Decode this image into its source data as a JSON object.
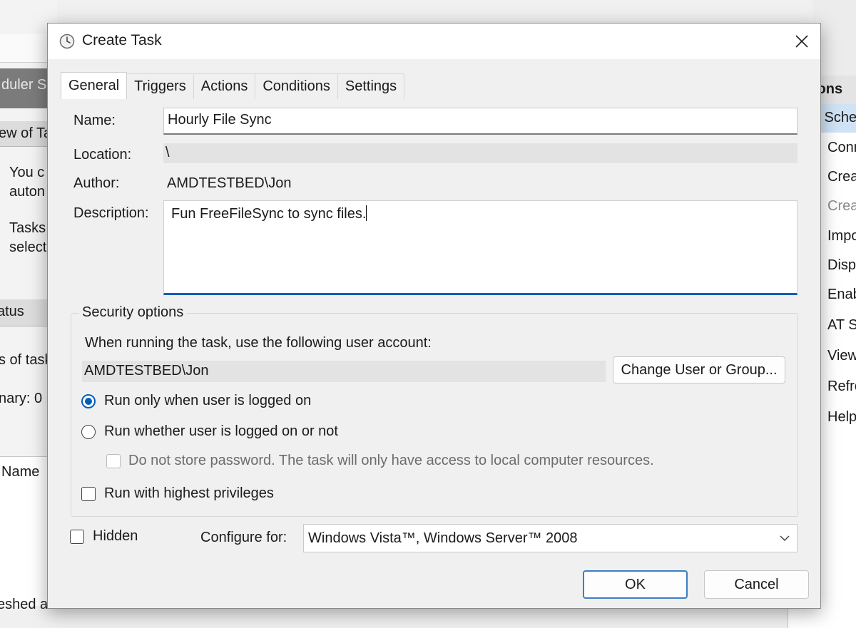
{
  "background": {
    "left_texts": [
      "duler Su",
      "ew of Ta",
      "You c",
      "auton",
      "Tasks",
      "select",
      "atus",
      "s of task",
      "nary: 0",
      "Name",
      "eshed at"
    ],
    "right_texts": [
      "ions",
      "k Sche",
      "Conn",
      "Crea",
      "Crea",
      "Impo",
      "Disp",
      "Enab",
      "AT Se",
      "View",
      "Refre",
      "Help"
    ]
  },
  "dialog": {
    "title": "Create Task",
    "tabs": [
      {
        "label": "General",
        "active": true
      },
      {
        "label": "Triggers",
        "active": false
      },
      {
        "label": "Actions",
        "active": false
      },
      {
        "label": "Conditions",
        "active": false
      },
      {
        "label": "Settings",
        "active": false
      }
    ],
    "general": {
      "name_label": "Name:",
      "name_value": "Hourly File Sync",
      "location_label": "Location:",
      "location_value": "\\",
      "author_label": "Author:",
      "author_value": "AMDTESTBED\\Jon",
      "description_label": "Description:",
      "description_value": "Fun FreeFileSync to sync files."
    },
    "security": {
      "legend": "Security options",
      "account_prompt": "When running the task, use the following user account:",
      "account_value": "AMDTESTBED\\Jon",
      "change_button": "Change User or Group...",
      "radio_logged_on": "Run only when user is logged on",
      "radio_whether": "Run whether user is logged on or not",
      "no_store_password": "Do not store password.  The task will only have access to local computer resources.",
      "highest_privileges": "Run with highest privileges",
      "selected_radio": "logged_on"
    },
    "hidden_label": "Hidden",
    "configure_label": "Configure for:",
    "configure_value": "Windows Vista™, Windows Server™ 2008",
    "ok_button": "OK",
    "cancel_button": "Cancel"
  }
}
